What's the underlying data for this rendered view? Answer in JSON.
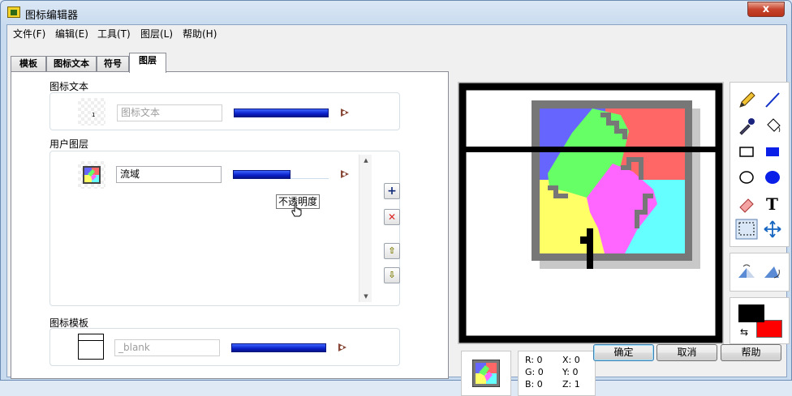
{
  "window": {
    "title": "图标编辑器",
    "close_label": "x"
  },
  "menu": [
    "文件(F)",
    "编辑(E)",
    "工具(T)",
    "图层(L)",
    "帮助(H)"
  ],
  "tabs": [
    {
      "label": "模板",
      "active": false
    },
    {
      "label": "图标文本",
      "active": false
    },
    {
      "label": "符号",
      "active": false
    },
    {
      "label": "图层",
      "active": true
    }
  ],
  "layers": {
    "icon_text": {
      "label": "图标文本",
      "input_value": "图标文本",
      "thumb_text": "1",
      "opacity": 1.0
    },
    "user_layers": {
      "label": "用户图层",
      "items": [
        {
          "name": "流域",
          "opacity": 0.6
        }
      ]
    },
    "template": {
      "label": "图标模板",
      "input_value": "_blank",
      "opacity": 1.0
    }
  },
  "tooltip": "不透明度",
  "readout": {
    "r": "R: 0",
    "g": "G: 0",
    "b": "B: 0",
    "x": "X: 0",
    "y": "Y: 0",
    "z": "Z: 1"
  },
  "buttons": {
    "ok": "确定",
    "cancel": "取消",
    "help": "帮助"
  },
  "tools": [
    "pencil-icon",
    "line-icon",
    "dropper-icon",
    "fill-bucket-icon",
    "rectangle-icon",
    "filled-rectangle-icon",
    "ellipse-icon",
    "filled-ellipse-icon",
    "eraser-icon",
    "text-icon",
    "select-icon",
    "move-icon"
  ],
  "colors": {
    "foreground": "#000000",
    "background": "#ff0000",
    "accent": "#0a1fc7",
    "quadrant_blue": "#6666ff",
    "quadrant_red": "#ff6666",
    "quadrant_yellow": "#ffff66",
    "quadrant_cyan": "#66ffff",
    "center_green": "#66ff66",
    "center_magenta": "#ff66ff"
  }
}
